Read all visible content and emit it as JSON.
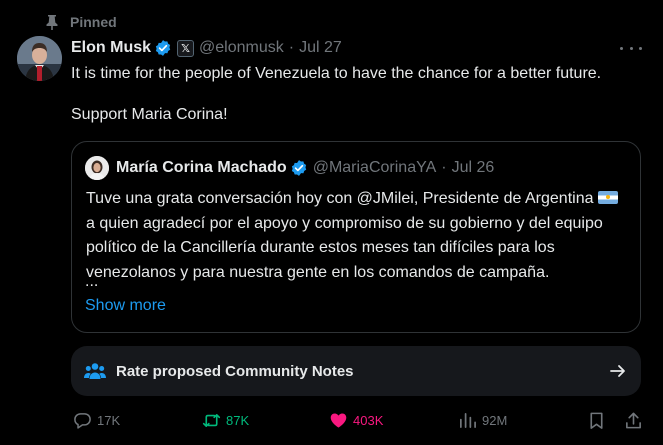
{
  "pinned": {
    "label": "Pinned",
    "icon": "pin-icon"
  },
  "post": {
    "author_name": "Elon Musk",
    "verified": true,
    "affiliation_badge": "𝕏",
    "handle": "@elonmusk",
    "separator": "·",
    "date": "Jul 27",
    "paragraphs": [
      "It is time for the people of Venezuela to have the chance for a better future.",
      "Support Maria Corina!"
    ]
  },
  "quote": {
    "author_name": "María Corina Machado",
    "verified": true,
    "handle": "@MariaCorinaYA",
    "separator": "·",
    "date": "Jul 26",
    "text_before_flag": "Tuve una grata conversación hoy con @JMilei, Presidente de Argentina",
    "flag_icon": "argentina-flag-icon",
    "text_after_flag": "a quien agradecí por el apoyo y compromiso de su gobierno y del equipo político de la Cancillería durante estos meses tan difíciles para los venezolanos y para nuestra gente en los comandos de campaña.",
    "ellipsis": "...",
    "show_more": "Show more"
  },
  "community_notes": {
    "label": "Rate proposed Community Notes",
    "icon": "people-icon",
    "action_icon": "arrow-right-icon"
  },
  "actions": {
    "reply_count": "17K",
    "retweet_count": "87K",
    "like_count": "403K",
    "views_count": "92M"
  },
  "colors": {
    "background": "#000000",
    "text": "#e7e9ea",
    "muted": "#71767b",
    "accent": "#1d9bf0",
    "retweet": "#00ba7c",
    "like": "#f91880",
    "card": "#16181c",
    "border": "#2f3336"
  }
}
